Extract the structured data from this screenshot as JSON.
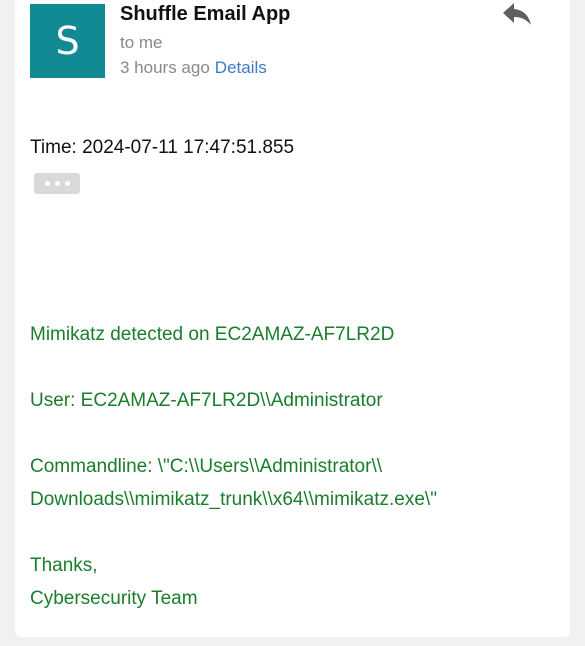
{
  "email": {
    "avatar_letter": "S",
    "sender": "Shuffle Email App",
    "recipient": "to me",
    "received": "3 hours ago",
    "details_label": "Details",
    "reply_icon": "reply-icon",
    "more_icon": "ellipsis-icon",
    "avatar_color": "#128a93",
    "link_color": "#3f78c8",
    "body_text_color": "#1a7d2c"
  },
  "body": {
    "time_line": "Time: 2024-07-11 17:47:51.855",
    "lines": [
      "Mimikatz detected on EC2AMAZ-AF7LR2D",
      "User: EC2AMAZ-AF7LR2D\\\\Administrator",
      "Commandline: \\\"C:\\\\Users\\\\Administrator\\\\",
      "Downloads\\\\mimikatz_trunk\\\\x64\\\\mimikatz.exe\\\"",
      "Thanks,",
      "Cybersecurity Team"
    ]
  }
}
